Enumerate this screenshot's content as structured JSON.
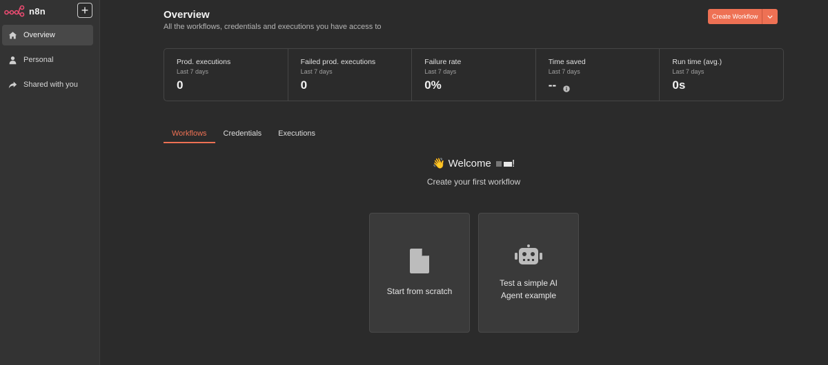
{
  "sidebar": {
    "brand_name": "n8n",
    "add_label": "+",
    "items": [
      {
        "label": "Overview",
        "icon": "home-icon",
        "active": true
      },
      {
        "label": "Personal",
        "icon": "user-icon",
        "active": false
      },
      {
        "label": "Shared with you",
        "icon": "share-icon",
        "active": false
      }
    ]
  },
  "header": {
    "title": "Overview",
    "subtitle": "All the workflows, credentials and executions you have access to",
    "create_label": "Create Workflow"
  },
  "stats": [
    {
      "label": "Prod. executions",
      "sub": "Last 7 days",
      "value": "0"
    },
    {
      "label": "Failed prod. executions",
      "sub": "Last 7 days",
      "value": "0"
    },
    {
      "label": "Failure rate",
      "sub": "Last 7 days",
      "value": "0%"
    },
    {
      "label": "Time saved",
      "sub": "Last 7 days",
      "value": "--"
    },
    {
      "label": "Run time (avg.)",
      "sub": "Last 7 days",
      "value": "0s"
    }
  ],
  "tabs": [
    {
      "label": "Workflows",
      "active": true
    },
    {
      "label": "Credentials",
      "active": false
    },
    {
      "label": "Executions",
      "active": false
    }
  ],
  "welcome": {
    "emoji": "👋",
    "text": "Welcome",
    "suffix": "!",
    "subtitle": "Create your first workflow"
  },
  "cards": [
    {
      "label": "Start from scratch",
      "icon": "file-icon"
    },
    {
      "label": "Test a simple AI Agent example",
      "icon": "robot-icon"
    }
  ],
  "colors": {
    "accent": "#ee7154",
    "background": "#2b2b2b",
    "sidebar": "#333333"
  }
}
